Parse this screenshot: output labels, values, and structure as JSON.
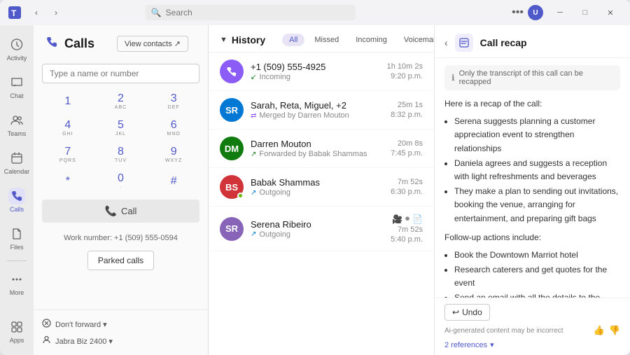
{
  "titlebar": {
    "app_icon": "🟦",
    "search_placeholder": "Search",
    "dots": "•••",
    "min": "─",
    "max": "□",
    "close": "✕"
  },
  "sidebar": {
    "items": [
      {
        "id": "activity",
        "label": "Activity",
        "icon": "🔔"
      },
      {
        "id": "chat",
        "label": "Chat",
        "icon": "💬"
      },
      {
        "id": "teams",
        "label": "Teams",
        "icon": "👥"
      },
      {
        "id": "calendar",
        "label": "Calendar",
        "icon": "📅"
      },
      {
        "id": "calls",
        "label": "Calls",
        "icon": "📞"
      },
      {
        "id": "files",
        "label": "Files",
        "icon": "📁"
      },
      {
        "id": "more",
        "label": "More",
        "icon": "•••"
      },
      {
        "id": "apps",
        "label": "Apps",
        "icon": "⊞"
      }
    ]
  },
  "calls": {
    "title": "Calls",
    "view_contacts_label": "View contacts ↗",
    "name_input_placeholder": "Type a name or number",
    "dialpad": [
      {
        "num": "1",
        "alpha": ""
      },
      {
        "num": "2",
        "alpha": "ABC"
      },
      {
        "num": "3",
        "alpha": "DEF"
      },
      {
        "num": "4",
        "alpha": "GHI"
      },
      {
        "num": "5",
        "alpha": "JKL"
      },
      {
        "num": "6",
        "alpha": "MNO"
      },
      {
        "num": "7",
        "alpha": "PQRS"
      },
      {
        "num": "8",
        "alpha": "TUV"
      },
      {
        "num": "9",
        "alpha": "WXYZ"
      },
      {
        "num": "*",
        "alpha": ""
      },
      {
        "num": "0",
        "alpha": "·"
      },
      {
        "num": "#",
        "alpha": ""
      }
    ],
    "call_btn_label": "Call",
    "work_number_label": "Work number: +1 (509) 555-0594",
    "parked_calls_label": "Parked calls",
    "bottom_options": [
      {
        "id": "dont-forward",
        "label": "Don't forward ▾",
        "icon": "⚙"
      },
      {
        "id": "jabra",
        "label": "Jabra Biz 2400 ▾",
        "icon": "⚙"
      }
    ]
  },
  "history": {
    "title": "History",
    "filters": [
      {
        "id": "all",
        "label": "All",
        "active": true
      },
      {
        "id": "missed",
        "label": "Missed",
        "active": false
      },
      {
        "id": "incoming",
        "label": "Incoming",
        "active": false
      },
      {
        "id": "voicemail",
        "label": "Voicemail",
        "active": false
      }
    ],
    "items": [
      {
        "id": "h1",
        "name": "+1 (509) 555-4925",
        "sub_text": "Incoming",
        "sub_type": "incoming",
        "avatar_color": "#8b5cf6",
        "avatar_initials": "📞",
        "duration": "1h 10m 2s",
        "time": "9:20 p.m.",
        "has_status": false
      },
      {
        "id": "h2",
        "name": "Sarah, Reta, Miguel, +2",
        "sub_text": "Merged by Darren Mouton",
        "sub_type": "merged",
        "avatar_color": "#0078d4",
        "avatar_initials": "SR",
        "duration": "25m 1s",
        "time": "8:32 p.m.",
        "has_status": false
      },
      {
        "id": "h3",
        "name": "Darren Mouton",
        "sub_text": "Forwarded by Babak Shammas",
        "sub_type": "incoming",
        "avatar_color": "#107c10",
        "avatar_initials": "DM",
        "duration": "20m 8s",
        "time": "7:45 p.m.",
        "has_status": false
      },
      {
        "id": "h4",
        "name": "Babak Shammas",
        "sub_text": "Outgoing",
        "sub_type": "outgoing",
        "avatar_color": "#d13438",
        "avatar_initials": "BS",
        "duration": "7m 52s",
        "time": "6:30 p.m.",
        "has_status": true,
        "status_type": "green"
      },
      {
        "id": "h5",
        "name": "Serena Ribeiro",
        "sub_text": "Outgoing",
        "sub_type": "outgoing",
        "avatar_color": "#8764b8",
        "avatar_initials": "SR2",
        "duration": "7m 52s",
        "time": "5:40 p.m.",
        "has_status": false,
        "has_action_icons": true
      }
    ]
  },
  "recap": {
    "title": "Call recap",
    "notice_text": "Only the transcript of this call can be recapped",
    "intro": "Here is a recap of the call:",
    "bullets": [
      "Serena suggests planning a customer appreciation event to strengthen relationships",
      "Daniela agrees and suggests a reception with light refreshments and beverages",
      "They make a plan to sending out invitations, booking the venue, arranging for entertainment, and preparing gift bags"
    ],
    "followup_title": "Follow-up actions include:",
    "followup_bullets": [
      "Book the Downtown Marriot hotel",
      "Research caterers and get quotes for the event",
      "Send an email with all the details to the team"
    ],
    "undo_label": "Undo",
    "ai_notice": "Ai-generated content may be incorrect",
    "references_label": "2 references",
    "thumbup": "👍",
    "thumbdown": "👎"
  }
}
